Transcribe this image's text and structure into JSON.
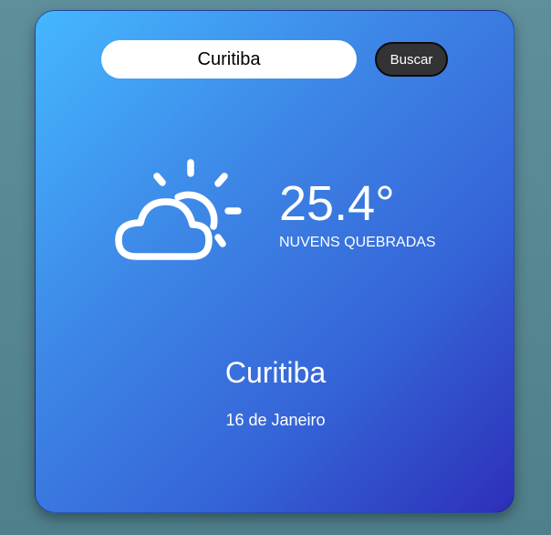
{
  "search": {
    "value": "Curitiba",
    "button_label": "Buscar"
  },
  "weather": {
    "icon": "partly-cloudy-icon",
    "temperature": "25.4°",
    "description": "NUVENS QUEBRADAS",
    "city": "Curitiba",
    "date": "16 de Janeiro"
  },
  "colors": {
    "page_background": "#5a8a96",
    "card_gradient_start": "#45b7ff",
    "card_gradient_end": "#2d2fb9",
    "button_background": "#333235",
    "text": "#ffffff"
  }
}
